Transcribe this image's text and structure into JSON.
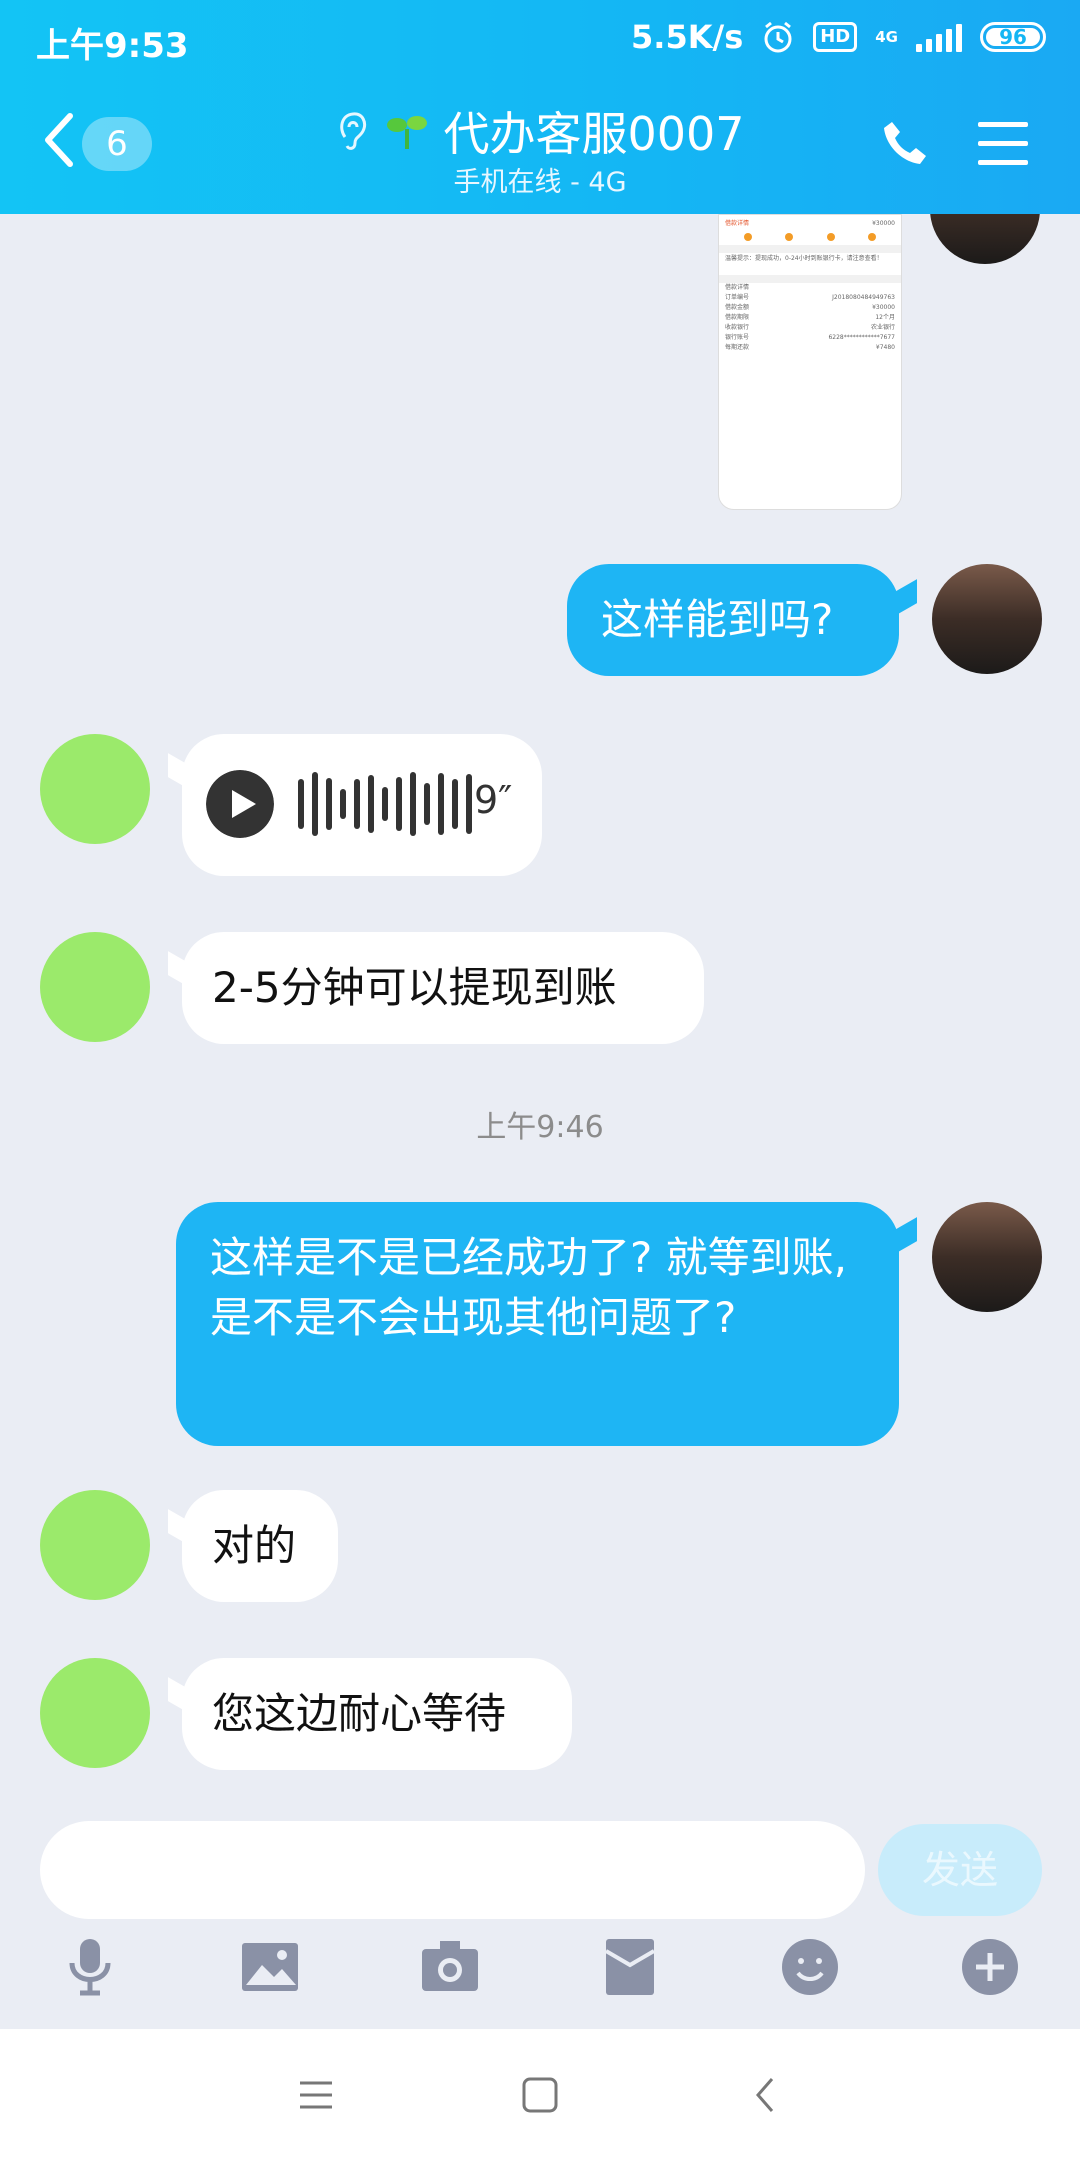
{
  "status_bar": {
    "time": "上午9:53",
    "speed": "5.5K/s",
    "hd": "HD",
    "network": "4G",
    "battery": "96"
  },
  "header": {
    "back_count": "6",
    "title": "代办客服0007",
    "subtitle": "手机在线 - 4G"
  },
  "messages": [
    {
      "side": "right",
      "type": "image"
    },
    {
      "side": "right",
      "type": "text",
      "text": "这样能到吗?"
    },
    {
      "side": "left",
      "type": "voice",
      "duration": "9″"
    },
    {
      "side": "left",
      "type": "text",
      "text": "2-5分钟可以提现到账"
    },
    {
      "type": "timestamp",
      "text": "上午9:46"
    },
    {
      "side": "right",
      "type": "text",
      "text": "这样是不是已经成功了? 就等到账, 是不是不会出现其他问题了?"
    },
    {
      "side": "left",
      "type": "text",
      "text": "对的"
    },
    {
      "side": "left",
      "type": "text",
      "text": "您这边耐心等待"
    }
  ],
  "image_preview": {
    "amount": "¥30000",
    "notice": "温馨提示：提现成功，0-24小时到账银行卡，请注意查看！",
    "section": "借款详情",
    "rows": [
      [
        "订单编号",
        "J2018080484949763"
      ],
      [
        "借款金额",
        "¥30000"
      ],
      [
        "借款期限",
        "12个月"
      ],
      [
        "收款银行",
        "农业银行"
      ],
      [
        "银行账号",
        "6228************7677"
      ],
      [
        "每期还款",
        "¥7480"
      ]
    ]
  },
  "input": {
    "placeholder": "",
    "send_label": "发送"
  },
  "colors": {
    "header": "#14b6f4",
    "bubble_right": "#1eb5f4",
    "bubble_left": "#ffffff",
    "background": "#eaedf4"
  }
}
